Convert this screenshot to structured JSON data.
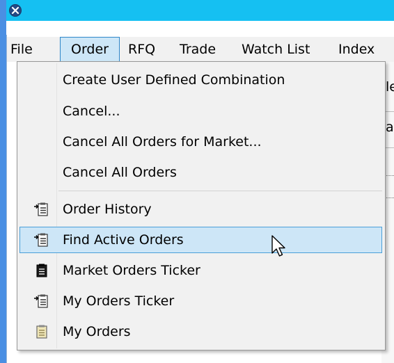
{
  "title_bar": {
    "color": "#15c0f2",
    "icon": "app-logo-icon"
  },
  "menu_bar": {
    "items": [
      {
        "label": "File"
      },
      {
        "label": "Order"
      },
      {
        "label": "RFQ"
      },
      {
        "label": "Trade"
      },
      {
        "label": "Watch List"
      },
      {
        "label": "Index"
      }
    ],
    "open_item": "Order"
  },
  "background_fragments": {
    "frag_1": "le",
    "frag_2": "at"
  },
  "order_menu": {
    "items": [
      {
        "label": "Create User Defined Combination",
        "icon": null
      },
      {
        "label": "Cancel...",
        "icon": null
      },
      {
        "label": "Cancel All Orders for Market...",
        "icon": null
      },
      {
        "label": "Cancel All Orders",
        "icon": null
      },
      {
        "label": "Order History",
        "icon": "list-arrow-icon"
      },
      {
        "label": "Find Active Orders",
        "icon": "list-arrow-icon",
        "highlighted": true
      },
      {
        "label": "Market Orders Ticker",
        "icon": "clipboard-dark-icon"
      },
      {
        "label": "My Orders Ticker",
        "icon": "list-arrow-icon"
      },
      {
        "label": "My Orders",
        "icon": "clipboard-light-icon"
      }
    ],
    "highlight_color": "#cde6f7"
  }
}
